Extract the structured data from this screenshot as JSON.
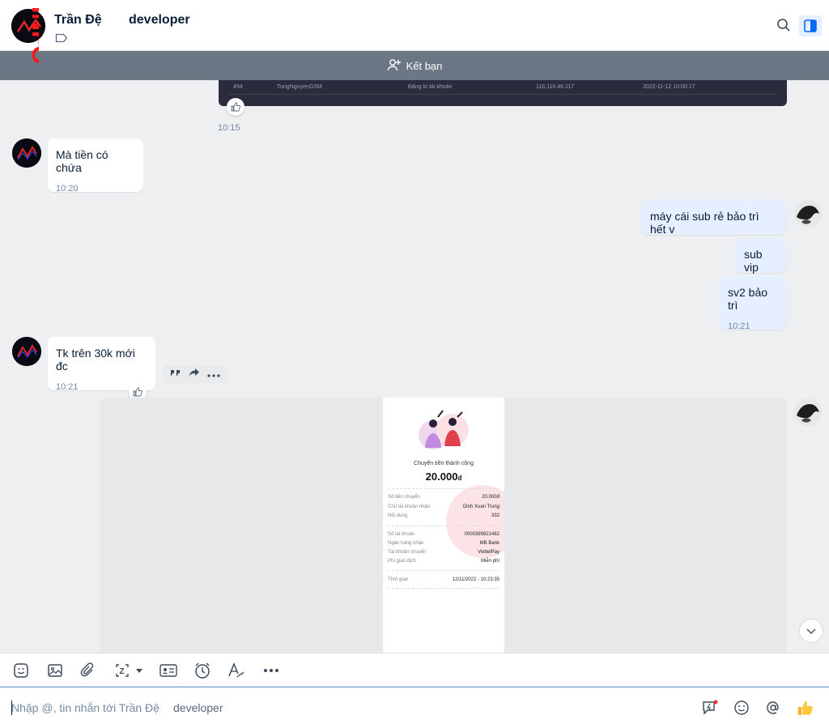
{
  "header": {
    "contact_name": "Trần Đệ",
    "contact_suffix": "developer",
    "search_icon": "search-icon",
    "panel_icon": "sidebar-toggle-icon"
  },
  "watermark": {
    "text": "INFO"
  },
  "friend_bar": {
    "label": "Kết bạn",
    "icon": "add-user-icon"
  },
  "messages": {
    "strip_row": {
      "id": "494",
      "user": "TungNguyenGSM",
      "action": "Đăng kí tài khoản",
      "ip": "116.110.46.117",
      "datetime": "2022-11-12 10:00:17"
    },
    "image_time": "10:15",
    "m1": {
      "text": "Mà tiền có chứa",
      "time": "10:20"
    },
    "m2": {
      "text": "máy cái sub rẻ bảo trì hết v"
    },
    "m3": {
      "text": "sub vip"
    },
    "m4": {
      "text": "sv2 bảo trì",
      "time": "10:21"
    },
    "m5": {
      "text": "Tk trên 30k mới đc",
      "time": "10:21"
    }
  },
  "receipt": {
    "title": "Chuyển tiền thành công",
    "amount": "20.000",
    "currency": "đ",
    "rows": [
      {
        "label": "Số tiền chuyển",
        "value": "20.000đ"
      },
      {
        "label": "Chủ tài khoản nhận",
        "value": "Dinh Xuan Trung"
      },
      {
        "label": "Nội dung",
        "value": "332"
      },
      {
        "label": "Số tài khoản",
        "value": "0000399821462"
      },
      {
        "label": "Ngân hàng nhận",
        "value": "MB Bank"
      },
      {
        "label": "Tài khoản chuyển",
        "value": "ViettelPay"
      },
      {
        "label": "Phí giao dịch",
        "value": "Miễn phí"
      },
      {
        "label": "Thời gian",
        "value": "12/11/2022 - 10:23:35"
      }
    ]
  },
  "toolbar": {
    "icons": [
      "sticker-icon",
      "image-icon",
      "attachment-icon",
      "screenshot-icon",
      "contact-card-icon",
      "reminder-icon",
      "text-format-icon",
      "more-icon"
    ]
  },
  "composer": {
    "placeholder": "Nhập @, tin nhắn tới Trần Đệ",
    "placeholder_suffix": "developer",
    "icons": [
      "quick-message-icon",
      "emoji-icon",
      "mention-icon",
      "thumbs-up-icon"
    ]
  },
  "colors": {
    "accent": "#0068ff",
    "outgoing_bubble": "#e5efff",
    "friend_bar": "#6b7785",
    "watermark": "#ff1a1a"
  }
}
